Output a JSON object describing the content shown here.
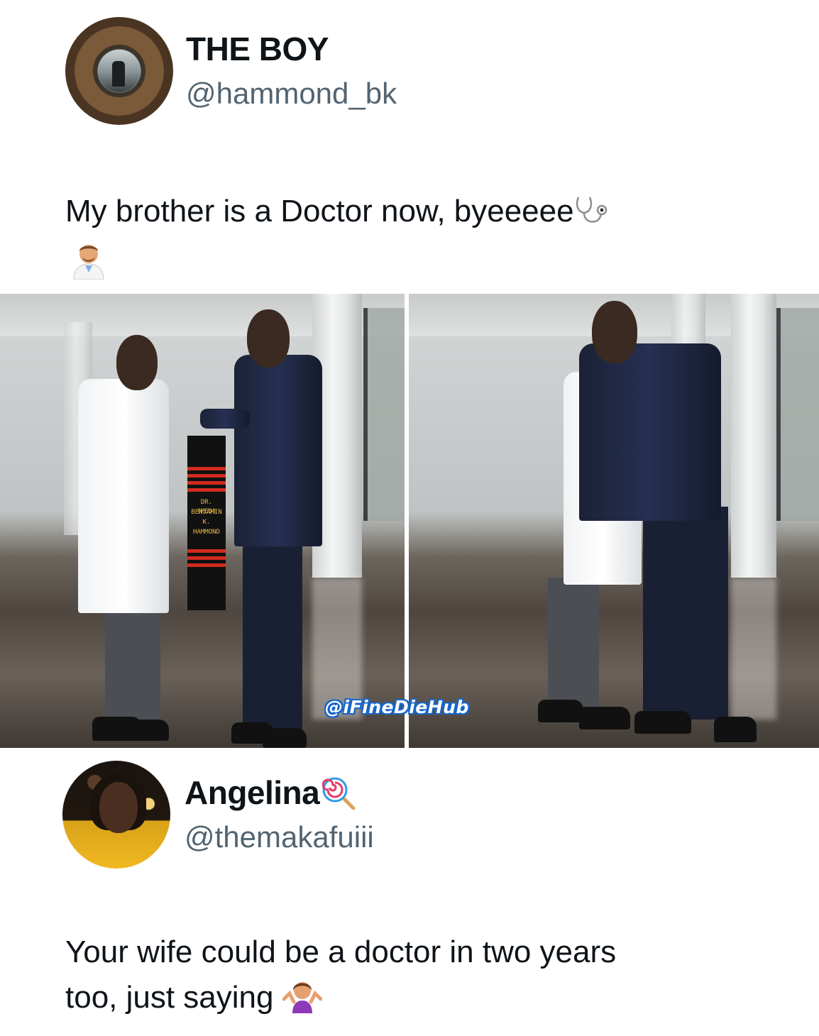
{
  "tweet": {
    "author": {
      "display_name": "THE BOY",
      "handle": "@hammond_bk",
      "avatar_icon": "avatar-the-boy"
    },
    "text": "My brother is a Doctor now, byeeeee",
    "emojis": [
      "stethoscope-icon",
      "man-health-worker-icon"
    ]
  },
  "media": {
    "photos": [
      "graduation-photo-sash",
      "graduation-photo-hug"
    ],
    "sash_text": [
      "DR. (MED)",
      "BENJAMIN",
      "K.",
      "HAMMOND"
    ],
    "watermark": "@iFineDieHub"
  },
  "reply": {
    "author": {
      "display_name": "Angelina",
      "handle": "@themakafuiii",
      "badge_icon": "lollipop-icon",
      "avatar_icon": "avatar-angelina"
    },
    "text_line1": "Your wife could be a doctor in two years",
    "text_line2": "too, just saying",
    "emoji": "woman-shrugging-icon"
  }
}
